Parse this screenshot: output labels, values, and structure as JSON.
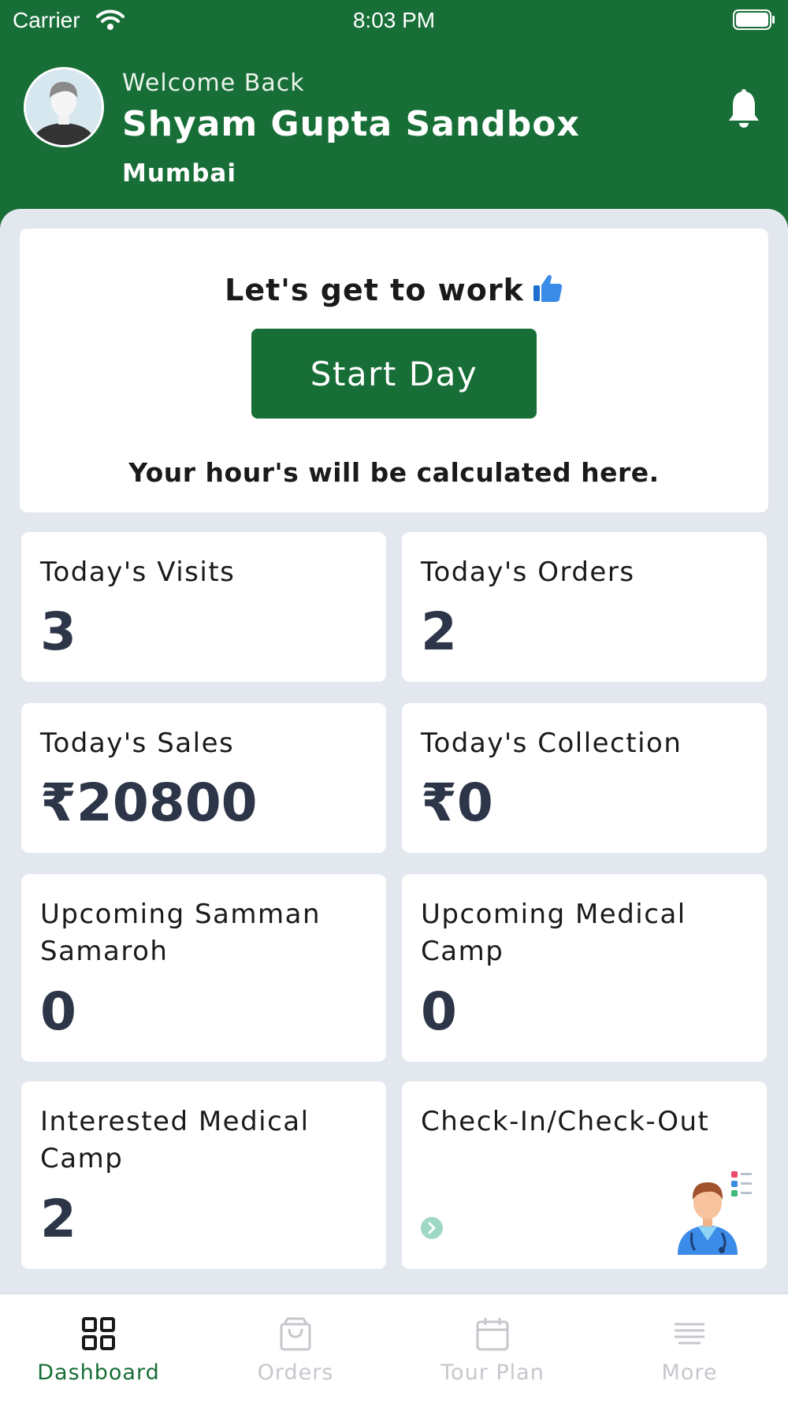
{
  "status_bar": {
    "carrier": "Carrier",
    "time": "8:03 PM"
  },
  "header": {
    "welcome": "Welcome Back",
    "user_name": "Shyam Gupta Sandbox",
    "city": "Mumbai"
  },
  "work_card": {
    "title": "Let's get to work",
    "start_button": "Start Day",
    "note": "Your hour's will be calculated here."
  },
  "tiles": [
    {
      "label": "Today's Visits",
      "value": "3"
    },
    {
      "label": "Today's Orders",
      "value": "2"
    },
    {
      "label": "Today's Sales",
      "value": "₹20800"
    },
    {
      "label": "Today's Collection",
      "value": "₹0"
    },
    {
      "label": "Upcoming Samman Samaroh",
      "value": "0"
    },
    {
      "label": "Upcoming Medical Camp",
      "value": "0"
    },
    {
      "label": "Interested Medical Camp",
      "value": "2"
    },
    {
      "label": "Check-In/Check-Out"
    }
  ],
  "tab_bar": {
    "tabs": [
      {
        "label": "Dashboard",
        "icon": "dashboard-grid-icon",
        "active": true
      },
      {
        "label": "Orders",
        "icon": "shopping-bag-icon",
        "active": false
      },
      {
        "label": "Tour Plan",
        "icon": "calendar-icon",
        "active": false
      },
      {
        "label": "More",
        "icon": "menu-lines-icon",
        "active": false
      }
    ]
  },
  "colors": {
    "brand_green": "#176e36",
    "background": "#e3e8ef",
    "value_text": "#2d3548",
    "inactive_tab": "#c4c7cc"
  }
}
